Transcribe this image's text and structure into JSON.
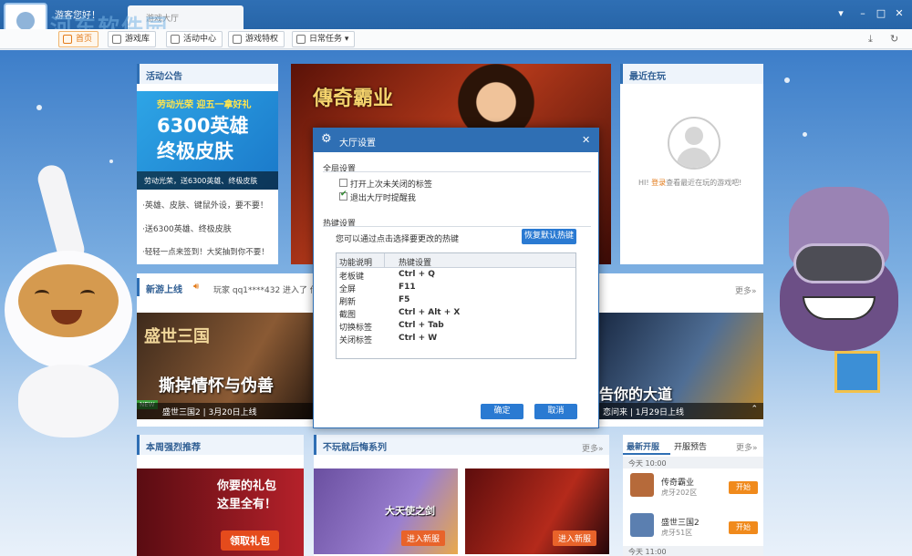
{
  "titlebar": {
    "greeting": "游客您好！",
    "tab_label": "游戏大厅",
    "watermark_cn": "河东软件园",
    "watermark_url": "www.pc0359.cn"
  },
  "nav": {
    "home": "首页",
    "library": "游戏库",
    "activity": "活动中心",
    "privilege": "游戏特权",
    "daily": "日常任务"
  },
  "announce": {
    "title": "活动公告",
    "banner_line1": "劳动光荣 迎五一拿好礼",
    "banner_line2": "6300英雄",
    "banner_line3": "终极皮肤",
    "banner_caption": "劳动光荣，送6300英雄、终极皮肤",
    "items": [
      "·英雄、皮肤、键鼠外设，要不要！",
      "·送6300英雄、终极皮肤",
      "·轻轻一点来签到！大奖抽到你不要！"
    ]
  },
  "recent": {
    "title": "最近在玩",
    "text_prefix": "HI! ",
    "login": "登录",
    "text_suffix": "查看最近在玩的游戏吧!"
  },
  "main_banner": {
    "logo": "傳奇霸业"
  },
  "newgame": {
    "title": "新游上线",
    "ticker": "玩家 qq1****432 进入了 传奇",
    "more": "更多»",
    "card1": {
      "logo": "盛世三国",
      "headline": "撕掉情怀与伪善",
      "badge": "NEW",
      "name": "盛世三国2",
      "date": "3月20日上线"
    },
    "card2": {
      "headline": "告你的大道",
      "name": "恋问来",
      "date": "1月29日上线"
    }
  },
  "dialog": {
    "title": "大厅设置",
    "general_label": "全局设置",
    "opt1": "打开上次未关闭的标签",
    "opt2": "退出大厅时提醒我",
    "hotkey_label": "热键设置",
    "hotkey_hint": "您可以通过点击选择要更改的热键",
    "restore": "恢复默认热键",
    "col1": "功能说明",
    "col2": "热键设置",
    "rows": [
      {
        "func": "老板键",
        "key": "Ctrl + Q"
      },
      {
        "func": "全屏",
        "key": "F11"
      },
      {
        "func": "刷新",
        "key": "F5"
      },
      {
        "func": "截图",
        "key": "Ctrl + Alt + X"
      },
      {
        "func": "切换标签",
        "key": "Ctrl + Tab"
      },
      {
        "func": "关闭标签",
        "key": "Ctrl + W"
      }
    ],
    "ok": "确定",
    "cancel": "取消"
  },
  "weekly": {
    "title": "本周强烈推荐",
    "banner_line1": "你要的礼包",
    "banner_line2": "这里全有！",
    "banner_btn": "领取礼包"
  },
  "regret": {
    "title": "不玩就后悔系列",
    "more": "更多»",
    "card1_logo": "大天使之剑",
    "card1_btn": "进入新服",
    "card2_btn": "进入新服"
  },
  "servers": {
    "tab1": "最新开服",
    "tab2": "开服预告",
    "more": "更多»",
    "today1": "今天 10:00",
    "game1": "传奇霸业",
    "server1": "虎牙202区",
    "start": "开始",
    "game2": "盛世三国2",
    "server2": "虎牙51区",
    "today2": "今天 11:00"
  },
  "colors": {
    "accent": "#2f6fb4",
    "orange": "#f08a1c",
    "link": "#e37b1a"
  }
}
